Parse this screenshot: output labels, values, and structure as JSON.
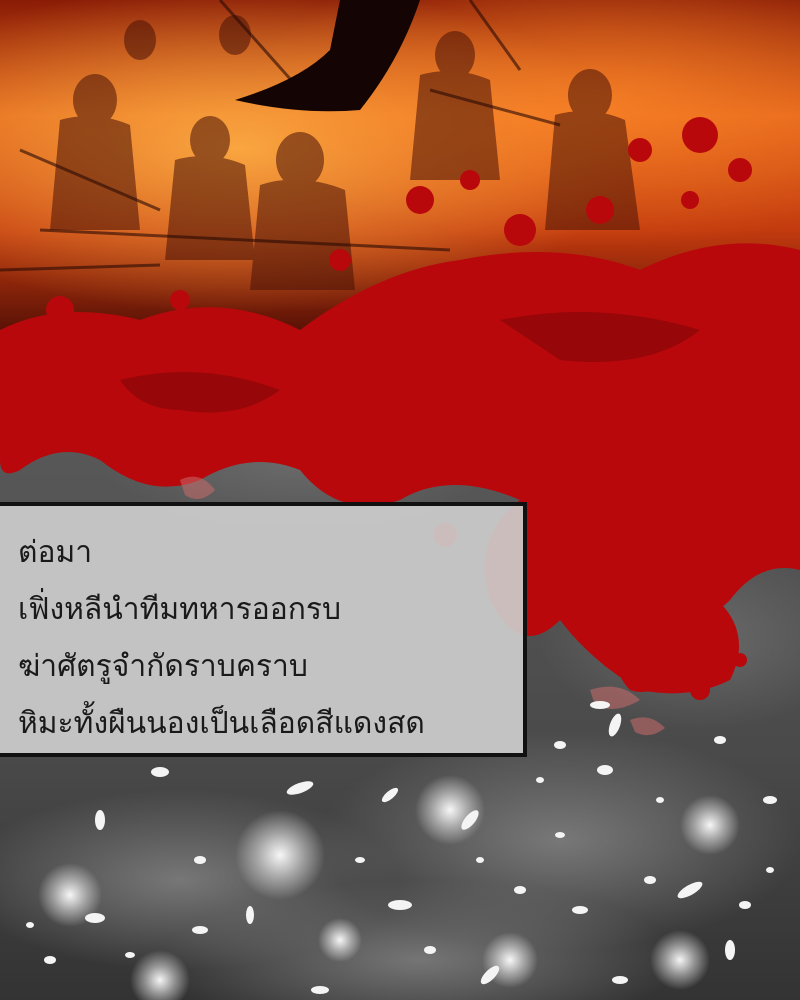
{
  "caption": {
    "lines": [
      "ต่อมา",
      "เฟิ่งหลีนำทีมทหารออกรบ",
      "ฆ่าศัตรูจำกัดราบคราบ",
      "หิมะทั้งผืนนองเป็นเลือดสีแดงสด"
    ]
  },
  "colors": {
    "fire_orange": "#e2631a",
    "fire_dark": "#6e1a08",
    "blood_red": "#b8080c",
    "smoke_gray": "#4a4a4a",
    "snow_white": "#f4f4f4",
    "caption_border": "#111111"
  }
}
